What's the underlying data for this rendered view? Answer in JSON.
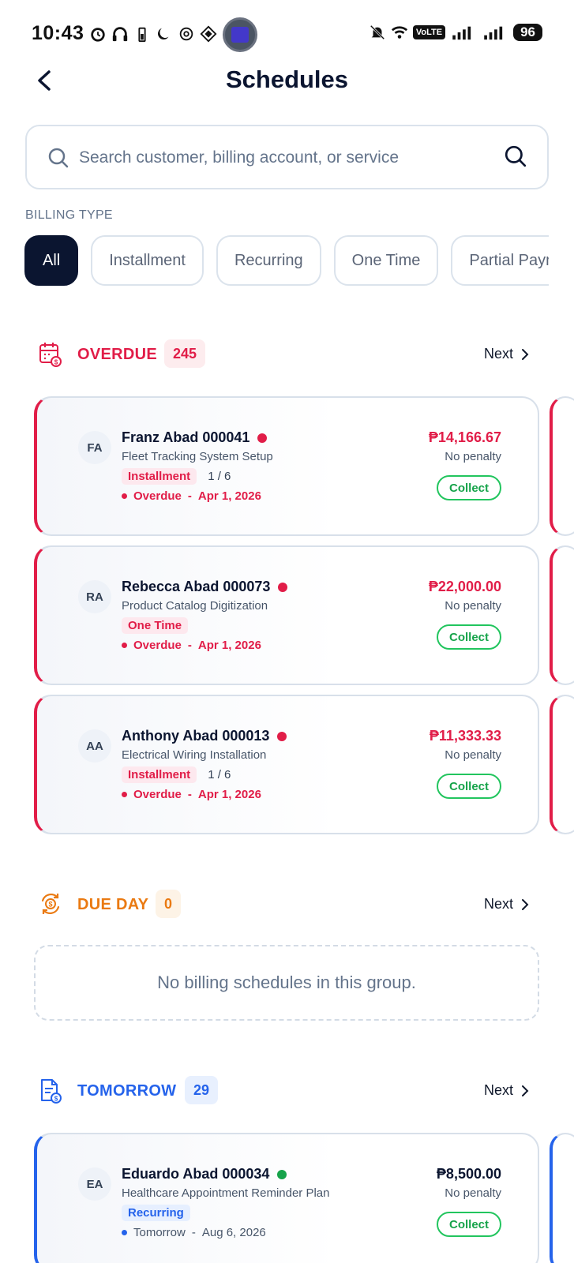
{
  "status_bar": {
    "time": "10:43",
    "network": "VoLTE",
    "battery": "96"
  },
  "header": {
    "title": "Schedules"
  },
  "search": {
    "placeholder": "Search customer, billing account, or service"
  },
  "filters": {
    "label": "BILLING TYPE",
    "chips": [
      "All",
      "Installment",
      "Recurring",
      "One Time",
      "Partial Payment"
    ],
    "selected": "All"
  },
  "groups": {
    "overdue": {
      "name": "OVERDUE",
      "count": "245",
      "next": "Next",
      "color": "#e11d48",
      "cards": [
        {
          "initials": "FA",
          "name": "Franz Abad 000041",
          "service": "Fleet Tracking System Setup",
          "tag": "Installment",
          "progress": "1 / 6",
          "status": "Overdue",
          "date": "Apr 1, 2026",
          "amount": "₱14,166.67",
          "penalty": "No penalty",
          "action": "Collect"
        },
        {
          "initials": "RA",
          "name": "Rebecca Abad 000073",
          "service": "Product Catalog Digitization",
          "tag": "One Time",
          "progress": "",
          "status": "Overdue",
          "date": "Apr 1, 2026",
          "amount": "₱22,000.00",
          "penalty": "No penalty",
          "action": "Collect"
        },
        {
          "initials": "AA",
          "name": "Anthony Abad 000013",
          "service": "Electrical Wiring Installation",
          "tag": "Installment",
          "progress": "1 / 6",
          "status": "Overdue",
          "date": "Apr 1, 2026",
          "amount": "₱11,333.33",
          "penalty": "No penalty",
          "action": "Collect"
        }
      ]
    },
    "due_day": {
      "name": "DUE DAY",
      "count": "0",
      "next": "Next",
      "color": "#ea7a12",
      "empty_text": "No billing schedules in this group."
    },
    "tomorrow": {
      "name": "TOMORROW",
      "count": "29",
      "next": "Next",
      "color": "#2563eb",
      "cards": [
        {
          "initials": "EA",
          "name": "Eduardo Abad 000034",
          "service": "Healthcare Appointment Reminder Plan",
          "tag": "Recurring",
          "progress": "",
          "status": "Tomorrow",
          "date": "Aug 6, 2026",
          "amount": "₱8,500.00",
          "penalty": "No penalty",
          "action": "Collect"
        }
      ]
    }
  }
}
